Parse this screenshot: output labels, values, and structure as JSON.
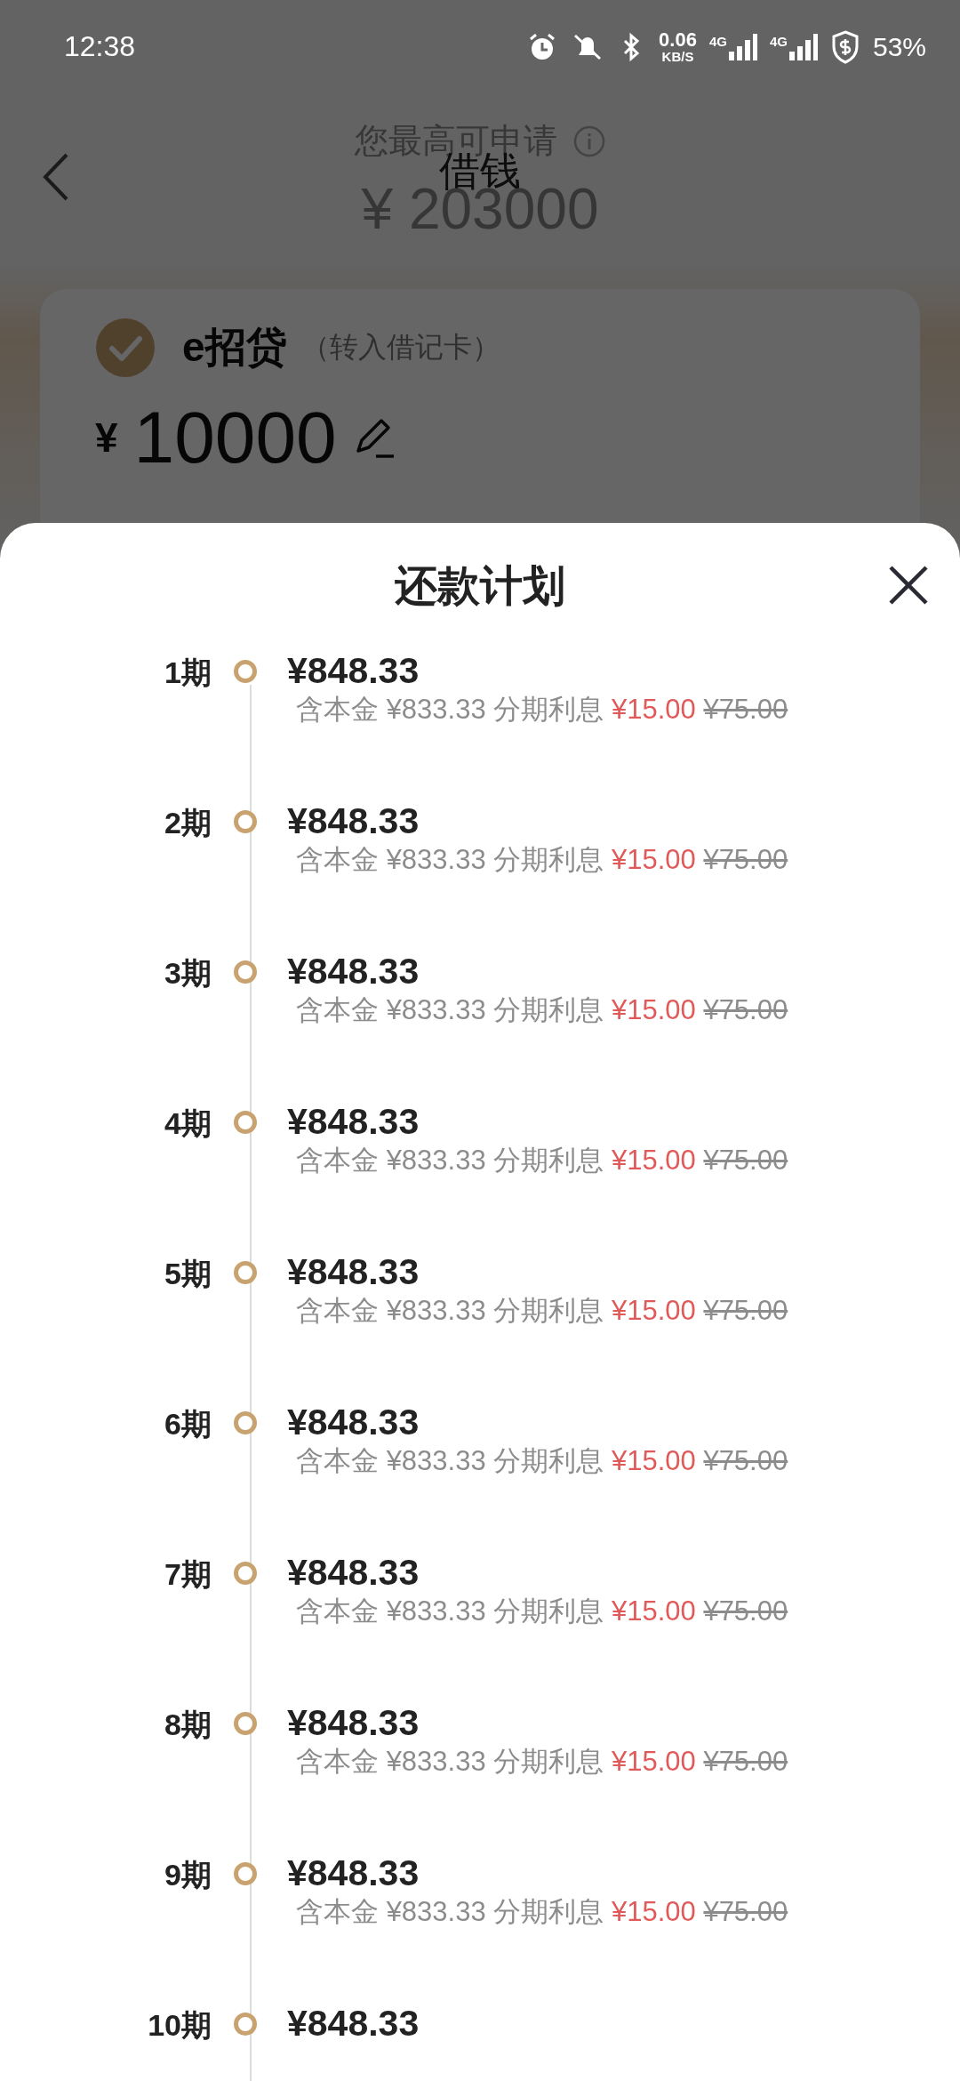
{
  "status_bar": {
    "time": "12:38",
    "net_speed": "0.06",
    "net_unit": "KB/S",
    "signal_labels": [
      "4G",
      "4G"
    ],
    "battery": "53%"
  },
  "header": {
    "limit_label": "您最高可申请",
    "title": "借钱",
    "limit_amount": "¥ 203000"
  },
  "loan_card": {
    "checked": true,
    "product": "e招贷",
    "note": "（转入借记卡）",
    "currency": "¥",
    "amount": "10000"
  },
  "sheet": {
    "title": "还款计划",
    "installments": [
      {
        "period": "1期",
        "amount": "¥848.33",
        "principal_label": "含本金",
        "principal": "¥833.33",
        "interest_label": "分期利息",
        "interest": "¥15.00",
        "original_interest": "¥75.00"
      },
      {
        "period": "2期",
        "amount": "¥848.33",
        "principal_label": "含本金",
        "principal": "¥833.33",
        "interest_label": "分期利息",
        "interest": "¥15.00",
        "original_interest": "¥75.00"
      },
      {
        "period": "3期",
        "amount": "¥848.33",
        "principal_label": "含本金",
        "principal": "¥833.33",
        "interest_label": "分期利息",
        "interest": "¥15.00",
        "original_interest": "¥75.00"
      },
      {
        "period": "4期",
        "amount": "¥848.33",
        "principal_label": "含本金",
        "principal": "¥833.33",
        "interest_label": "分期利息",
        "interest": "¥15.00",
        "original_interest": "¥75.00"
      },
      {
        "period": "5期",
        "amount": "¥848.33",
        "principal_label": "含本金",
        "principal": "¥833.33",
        "interest_label": "分期利息",
        "interest": "¥15.00",
        "original_interest": "¥75.00"
      },
      {
        "period": "6期",
        "amount": "¥848.33",
        "principal_label": "含本金",
        "principal": "¥833.33",
        "interest_label": "分期利息",
        "interest": "¥15.00",
        "original_interest": "¥75.00"
      },
      {
        "period": "7期",
        "amount": "¥848.33",
        "principal_label": "含本金",
        "principal": "¥833.33",
        "interest_label": "分期利息",
        "interest": "¥15.00",
        "original_interest": "¥75.00"
      },
      {
        "period": "8期",
        "amount": "¥848.33",
        "principal_label": "含本金",
        "principal": "¥833.33",
        "interest_label": "分期利息",
        "interest": "¥15.00",
        "original_interest": "¥75.00"
      },
      {
        "period": "9期",
        "amount": "¥848.33",
        "principal_label": "含本金",
        "principal": "¥833.33",
        "interest_label": "分期利息",
        "interest": "¥15.00",
        "original_interest": "¥75.00"
      },
      {
        "period": "10期",
        "amount": "¥848.33"
      }
    ]
  }
}
